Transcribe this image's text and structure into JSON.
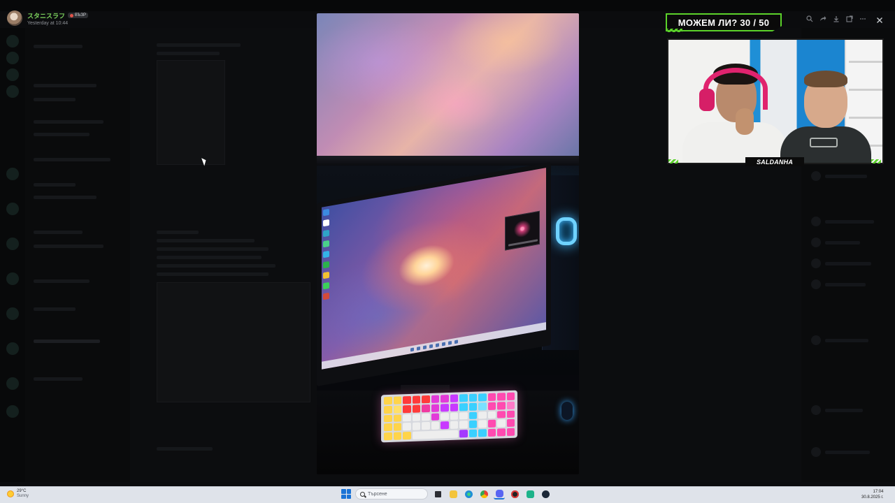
{
  "viewer": {
    "username": "スタニスラフ",
    "badge": "ВЪЗР",
    "timestamp": "Yesterday at 10:44"
  },
  "overlay": {
    "counter_text": "МОЖЕМ ЛИ? 30 / 50",
    "counter_value": 30,
    "counter_total": 50,
    "streamer_name": "SALDANHA"
  },
  "toolbar": {
    "zoom_icon": "zoom-icon",
    "forward_icon": "forward-icon",
    "download_icon": "download-icon",
    "open_icon": "open-external-icon",
    "more_icon": "more-icon",
    "close_icon": "close-icon"
  },
  "taskbar": {
    "weather_temp": "29°C",
    "weather_cond": "Sunny",
    "search_placeholder": "Търсене",
    "time": "17:04",
    "date": "30.8.2025 г.",
    "apps": [
      "file-explorer",
      "edge",
      "chrome",
      "discord",
      "game-app",
      "app",
      "steam"
    ]
  },
  "colors": {
    "accent_green": "#5bd22a",
    "username_green": "#7ed45e",
    "headphones_pink": "#e0236e",
    "windows_blue": "#1a73d6"
  }
}
